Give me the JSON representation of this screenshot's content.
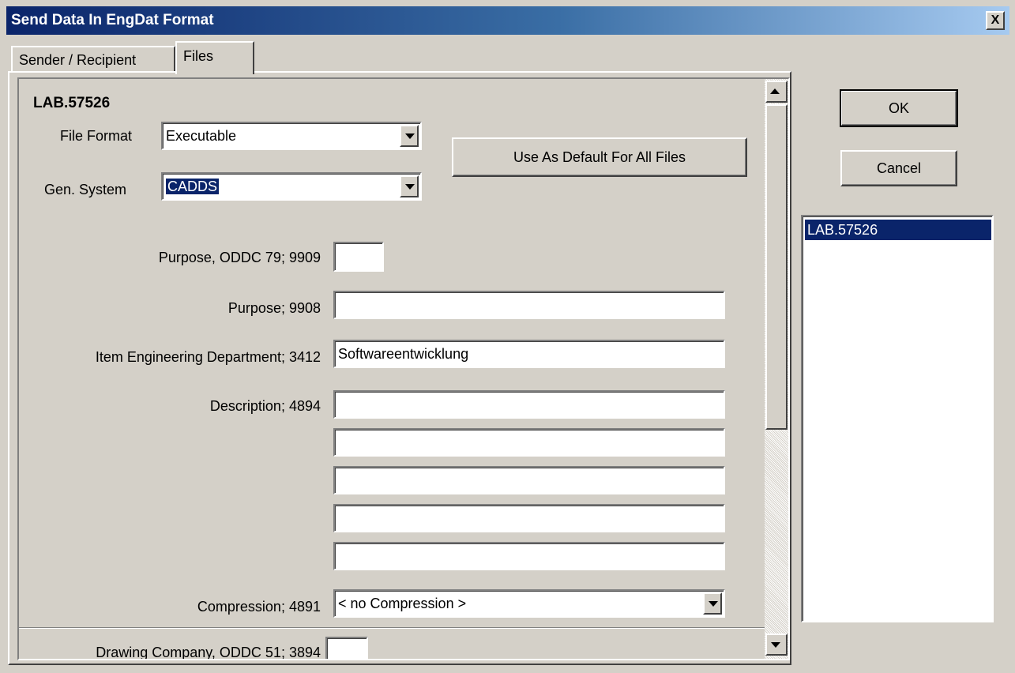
{
  "window": {
    "title": "Send Data In EngDat Format",
    "close_label": "X"
  },
  "tabs": [
    {
      "label": "Sender / Recipient"
    },
    {
      "label": "Files"
    }
  ],
  "file_panel": {
    "file_name": "LAB.57526",
    "file_format": {
      "label": "File Format",
      "value": "Executable"
    },
    "gen_system": {
      "label": "Gen. System",
      "value": "CADDS"
    },
    "default_button": "Use As Default For All Files",
    "purpose_oddc": {
      "label": "Purpose, ODDC 79; 9909",
      "value": ""
    },
    "purpose": {
      "label": "Purpose; 9908",
      "value": ""
    },
    "item_eng_dept": {
      "label": "Item Engineering Department; 3412",
      "value": "Softwareentwicklung"
    },
    "description": {
      "label": "Description; 4894",
      "lines": [
        "",
        "",
        "",
        "",
        ""
      ]
    },
    "compression": {
      "label": "Compression; 4891",
      "value": "< no Compression >"
    },
    "drawing_company": {
      "label": "Drawing Company, ODDC 51; 3894",
      "value": ""
    }
  },
  "buttons": {
    "ok": "OK",
    "cancel": "Cancel"
  },
  "file_list": {
    "items": [
      "LAB.57526"
    ]
  }
}
